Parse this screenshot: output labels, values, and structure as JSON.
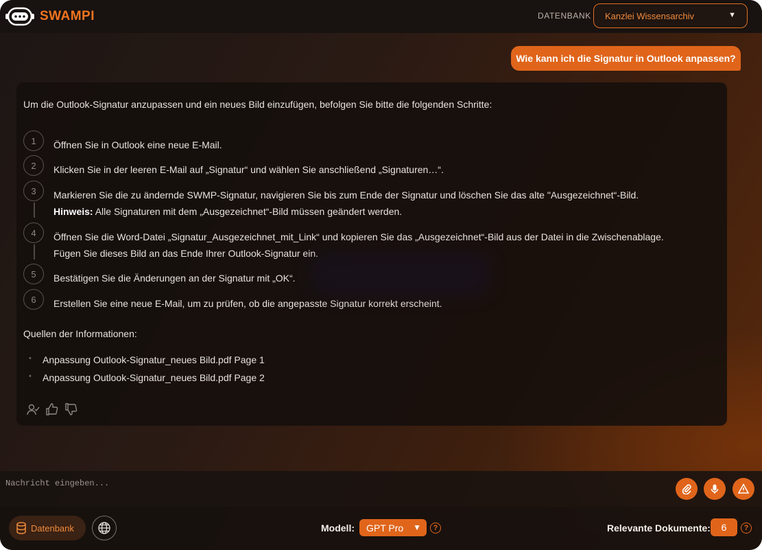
{
  "header": {
    "logo_text": "SWAMPI",
    "database_label": "DATENBANK",
    "database_selected": "Kanzlei Wissensarchiv"
  },
  "chat": {
    "user_message": "Wie kann ich die Signatur in Outlook anpassen?",
    "answer": {
      "intro": "Um die Outlook-Signatur anzupassen und ein neues Bild einzufügen, befolgen Sie bitte die folgenden Schritte:",
      "steps": [
        {
          "num": "1",
          "text": "Öffnen Sie in Outlook eine neue E-Mail."
        },
        {
          "num": "2",
          "text": "Klicken Sie in der leeren E-Mail auf „Signatur“ und wählen Sie anschließend „Signaturen…“."
        },
        {
          "num": "3",
          "text": "Markieren Sie die zu ändernde SWMP-Signatur, navigieren Sie bis zum Ende der Signatur und löschen Sie das alte \"Ausgezeichnet“-Bild.",
          "hint_label": "Hinweis:",
          "hint_text": "Alle Signaturen mit dem „Ausgezeichnet“-Bild müssen geändert werden."
        },
        {
          "num": "4",
          "text": "Öffnen Sie die Word-Datei „Signatur_Ausgezeichnet_mit_Link“ und kopieren Sie das „Ausgezeichnet“-Bild aus der Datei in die Zwischenablage.",
          "text2": "Fügen Sie dieses Bild an das Ende Ihrer Outlook-Signatur ein."
        },
        {
          "num": "5",
          "text": "Bestätigen Sie die Änderungen an der Signatur mit „OK“."
        },
        {
          "num": "6",
          "text": "Erstellen Sie eine neue E-Mail, um zu prüfen, ob die angepasste Signatur korrekt erscheint."
        }
      ],
      "sources_title": "Quellen der Informationen:",
      "sources": [
        "Anpassung Outlook-Signatur_neues Bild.pdf Page 1",
        "Anpassung Outlook-Signatur_neues Bild.pdf Page 2"
      ]
    }
  },
  "input": {
    "placeholder": "Nachricht eingeben..."
  },
  "toolbar": {
    "database_button": "Datenbank",
    "model_label": "Modell:",
    "model_value": "GPT Pro",
    "docs_label": "Relevante Dokumente:",
    "docs_count": "6",
    "help_glyph": "?"
  },
  "colors": {
    "accent": "#e0651b",
    "accent_text": "#f08a3b"
  }
}
